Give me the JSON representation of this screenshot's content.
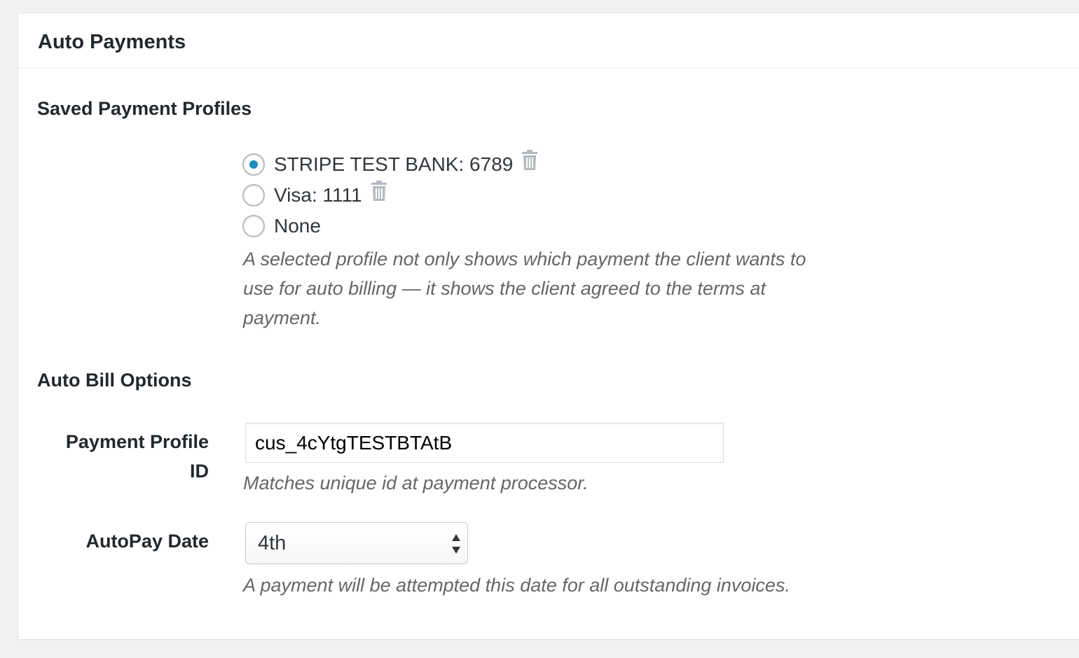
{
  "panel": {
    "title": "Auto Payments"
  },
  "saved_profiles": {
    "heading": "Saved Payment Profiles",
    "options": [
      {
        "label": "STRIPE TEST BANK: 6789",
        "checked": true,
        "deletable": true,
        "icon": "trash-icon"
      },
      {
        "label": "Visa: 1111",
        "checked": false,
        "deletable": true,
        "icon": "trash-icon"
      },
      {
        "label": "None",
        "checked": false,
        "deletable": false
      }
    ],
    "description_line1": "A selected profile not only shows which payment the client wants to",
    "description_line2": "use for auto billing — it shows the client agreed to the terms at",
    "description_line3": "payment."
  },
  "auto_bill": {
    "heading": "Auto Bill Options",
    "profile_id_label_line1": "Payment Profile",
    "profile_id_label_line2": "ID",
    "profile_id_value": "cus_4cYtgTESTBTAtB",
    "profile_id_description": "Matches unique id at payment processor.",
    "autopay_label": "AutoPay Date",
    "autopay_value": "4th",
    "autopay_description": "A payment will be attempted this date for all outstanding invoices."
  },
  "colors": {
    "radio_dot": "#1e8cbe",
    "trash_icon": "#b4b9be",
    "description_text": "#666666",
    "page_background": "#f1f1f1"
  }
}
